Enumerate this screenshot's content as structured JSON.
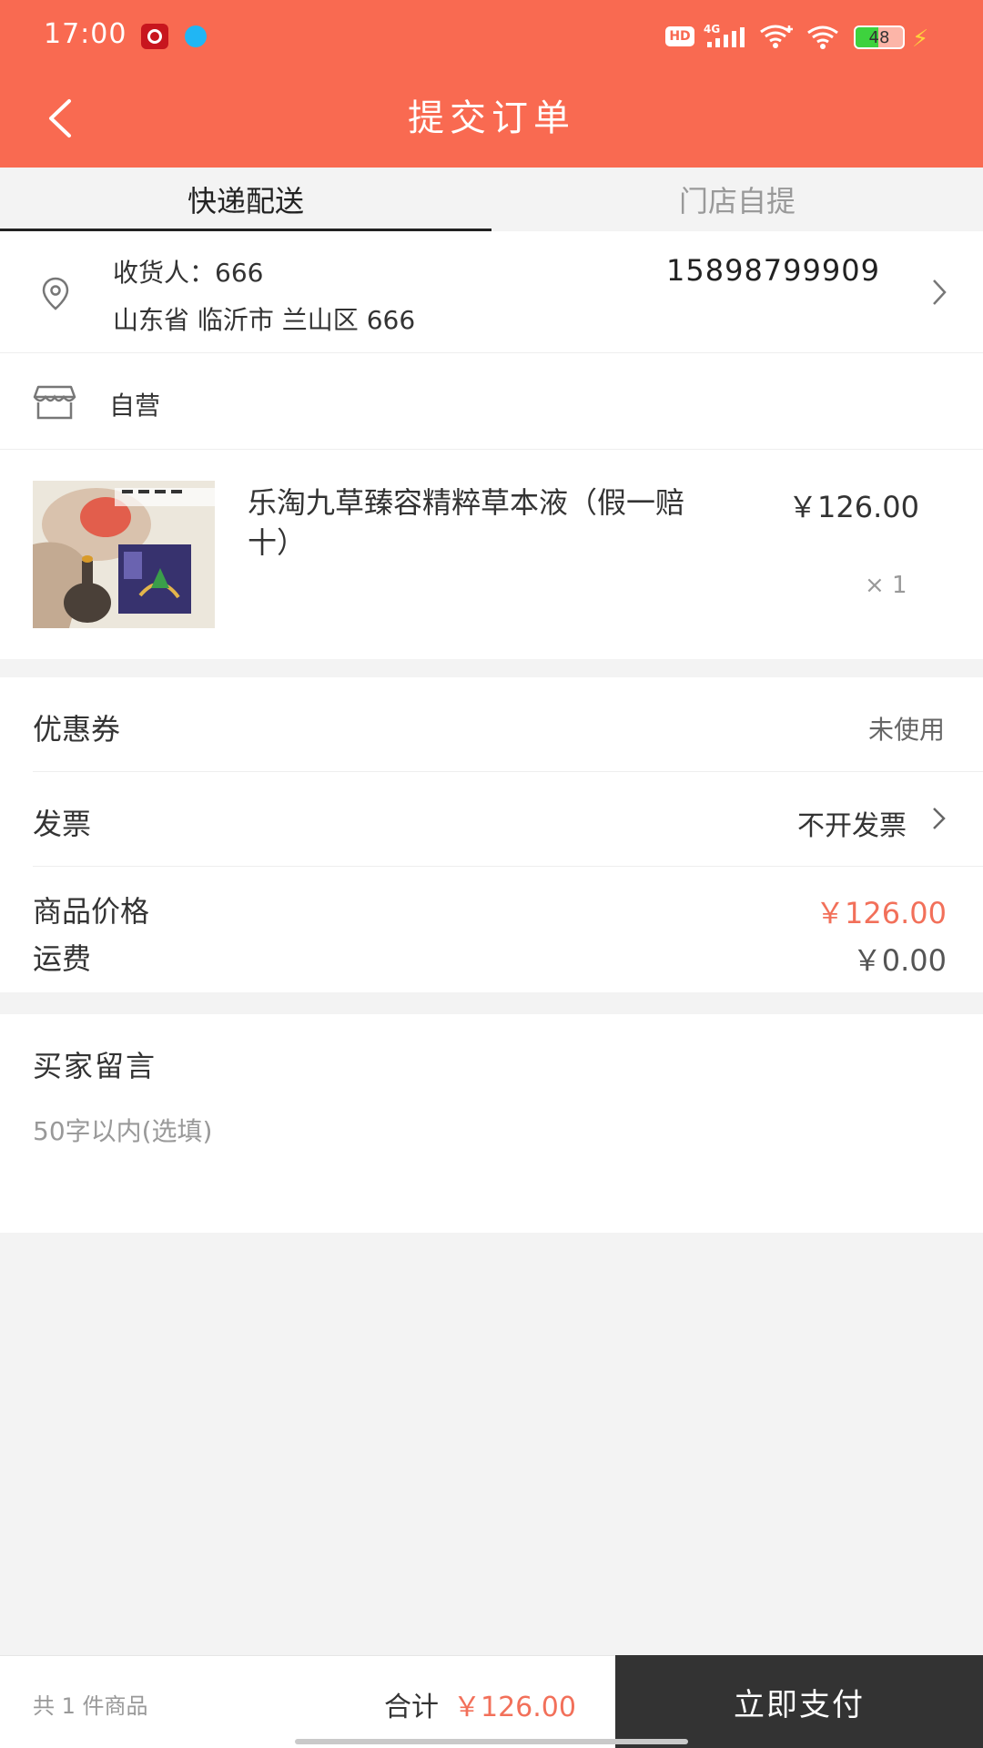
{
  "status_bar": {
    "time": "17:00",
    "hd": "HD",
    "network": "4G",
    "battery": "48",
    "battery_level": 0.48
  },
  "header": {
    "title": "提交订单"
  },
  "tabs": [
    {
      "label": "快递配送",
      "active": true
    },
    {
      "label": "门店自提",
      "active": false
    }
  ],
  "address": {
    "receiver": "收货人：666",
    "phone": "15898799909",
    "detail": "山东省 临沂市 兰山区 666"
  },
  "store": {
    "name": "自营"
  },
  "product": {
    "title": "乐淘九草臻容精粹草本液（假一赔十）",
    "price": "￥126.00",
    "quantity": "× 1"
  },
  "options": {
    "coupon_label": "优惠券",
    "coupon_value": "未使用",
    "invoice_label": "发票",
    "invoice_value": "不开发票",
    "goods_price_label": "商品价格",
    "goods_price_value": "￥126.00",
    "freight_label": "运费",
    "freight_value": "￥0.00"
  },
  "message": {
    "title": "买家留言",
    "placeholder": "50字以内(选填)"
  },
  "footer": {
    "count": "共 1 件商品",
    "total_label": "合计",
    "total_value": "￥126.00",
    "pay_button": "立即支付"
  },
  "colors": {
    "header_bg": "#f96a51",
    "price_accent": "#f2705a",
    "pay_button_bg": "#333333"
  }
}
